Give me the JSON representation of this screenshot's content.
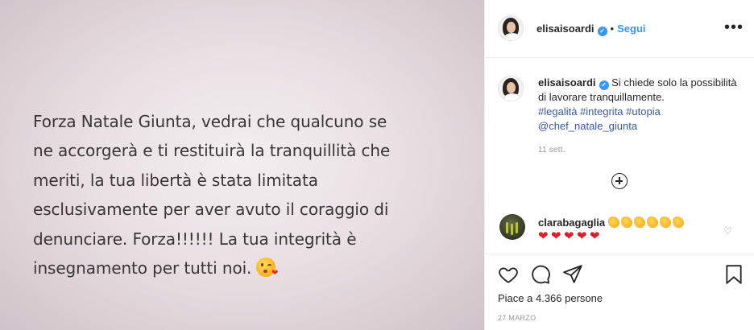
{
  "post": {
    "image_text": "Forza Natale Giunta, vedrai che qualcuno se\nne accorgerà e ti restituirà la tranquillità  che\nmeriti, la tua libertà è stata limitata\nesclusivamente per aver avuto il coraggio di\ndenunciare. Forza!!!!!!  La tua integrità è\ninsegnamento per tutti noi.",
    "image_emoji": "kissing-face-emoji"
  },
  "header": {
    "username": "elisaisoardi",
    "separator": "•",
    "follow_label": "Segui",
    "more_label": "•••"
  },
  "caption": {
    "username": "elisaisoardi",
    "text": "Si chiede solo la possibilità di lavorare tranquillamente.",
    "hashtags": [
      "#legalità",
      "#integrita",
      "#utopia"
    ],
    "mention": "@chef_natale_giunta",
    "time_ago": "11 sett."
  },
  "comments": [
    {
      "username": "clarabagaglia",
      "emoji_line_1": [
        "clap",
        "clap",
        "clap",
        "clap",
        "clap",
        "clap"
      ],
      "emoji_line_2": [
        "heart",
        "heart",
        "heart",
        "heart",
        "heart"
      ]
    }
  ],
  "actions": {
    "like_icon": "heart-outline-icon",
    "comment_icon": "comment-bubble-icon",
    "share_icon": "paper-plane-icon",
    "save_icon": "bookmark-icon"
  },
  "likes": {
    "text": "Piace a 4.366 persone"
  },
  "date": "27 MARZO",
  "colors": {
    "link_blue": "#3897f0",
    "hashtag_blue": "#3b5996",
    "muted_gray": "#999999",
    "text_dark": "#262626"
  }
}
